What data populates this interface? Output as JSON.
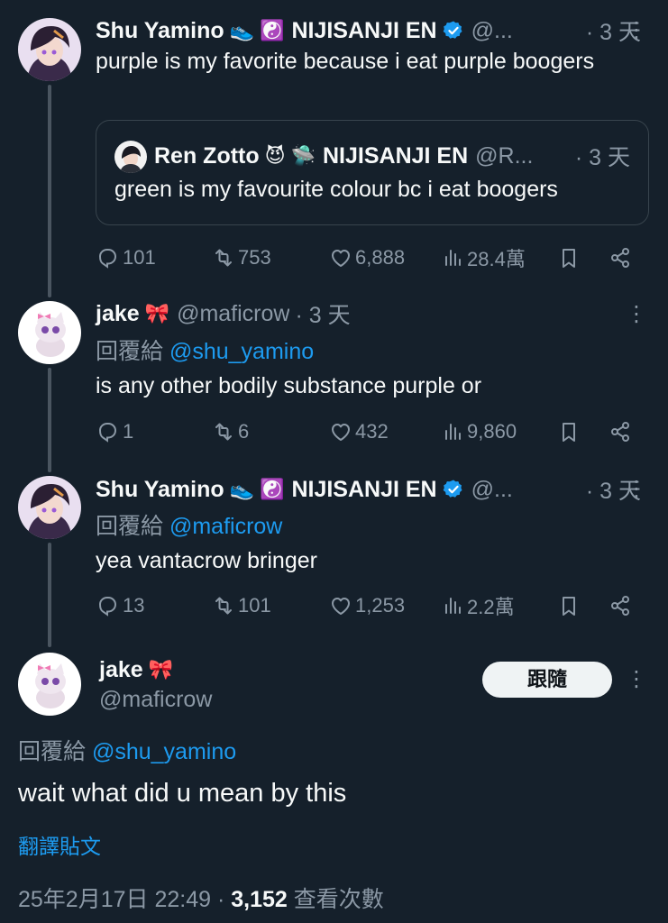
{
  "colors": {
    "background": "#15202b",
    "text": "#f7f9f9",
    "muted": "#8b98a5",
    "link": "#1d9bf0",
    "verified": "#1d9bf0"
  },
  "tweets": [
    {
      "name": "Shu Yamino",
      "emoji1": "👟",
      "emoji2": "☯️",
      "affiliation": "NIJISANJI EN",
      "verified": true,
      "handle": "@...",
      "time": "· 3 天",
      "text": "purple is my favorite because i eat purple boogers",
      "quote": {
        "name": "Ren Zotto",
        "emoji1": "😈",
        "emoji2": "🛸",
        "affiliation": "NIJISANJI EN",
        "handle": "@R...",
        "time": "· 3 天",
        "text": "green is my favourite colour bc i eat boogers"
      },
      "replies": "101",
      "reposts": "753",
      "likes": "6,888",
      "views": "28.4萬"
    },
    {
      "name": "jake",
      "emoji1": "🎀",
      "handle": "@maficrow",
      "time": "· 3 天",
      "reply_prefix": "回覆給",
      "reply_to": "@shu_yamino",
      "text": "is any other bodily substance purple or",
      "replies": "1",
      "reposts": "6",
      "likes": "432",
      "views": "9,860"
    },
    {
      "name": "Shu Yamino",
      "emoji1": "👟",
      "emoji2": "☯️",
      "affiliation": "NIJISANJI EN",
      "verified": true,
      "handle": "@...",
      "time": "· 3 天",
      "reply_prefix": "回覆給",
      "reply_to": "@maficrow",
      "text": "yea vantacrow bringer",
      "replies": "13",
      "reposts": "101",
      "likes": "1,253",
      "views": "2.2萬"
    }
  ],
  "focused": {
    "name": "jake",
    "emoji1": "🎀",
    "handle": "@maficrow",
    "follow_label": "跟隨",
    "reply_prefix": "回覆給",
    "reply_to": "@shu_yamino",
    "text": "wait what did u mean by this",
    "translate_label": "翻譯貼文",
    "timestamp": "25年2月17日 22:49",
    "separator": "·",
    "view_count": "3,152",
    "view_label": "查看次數"
  }
}
